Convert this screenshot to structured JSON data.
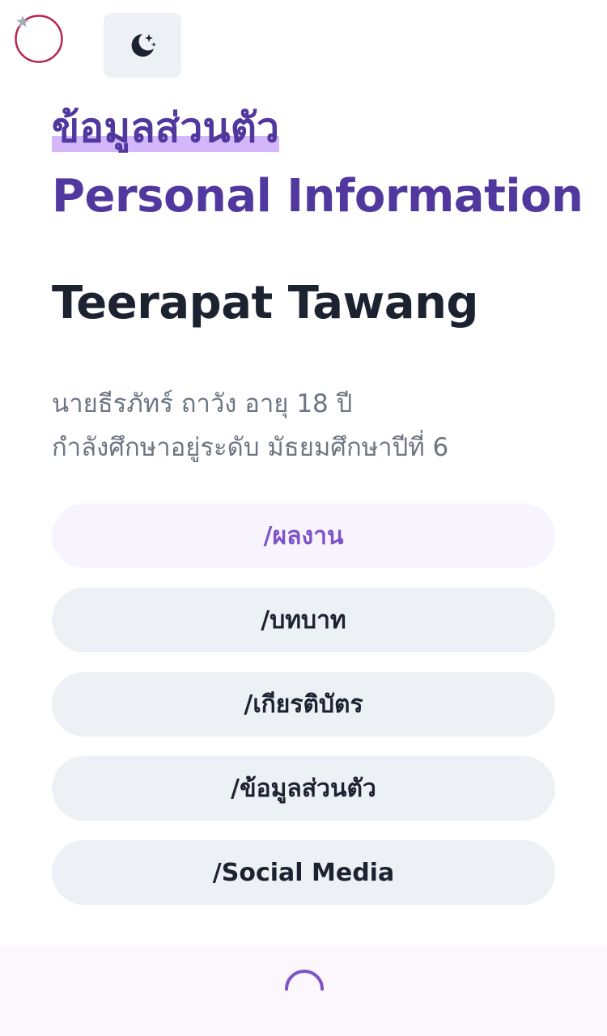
{
  "header": {
    "logo_icon": "circle-logo-icon",
    "theme_toggle_icon": "moon-stars-icon"
  },
  "title": {
    "thai": "ข้อมูลส่วนตัว",
    "english": "Personal Information"
  },
  "profile": {
    "name": "Teerapat Tawang",
    "line1": "นายธีรภัทร์ ถาวัง อายุ 18 ปี",
    "line2": "กำลังศึกษาอยู่ระดับ มัธยมศึกษาปีที่ 6"
  },
  "nav": [
    {
      "label": "/ผลงาน",
      "active": true
    },
    {
      "label": "/บทบาท",
      "active": false
    },
    {
      "label": "/เกียรติบัตร",
      "active": false
    },
    {
      "label": "/ข้อมูลส่วนตัว",
      "active": false
    },
    {
      "label": "/Social Media",
      "active": false
    }
  ],
  "footer": {
    "loading_icon": "loading-spinner-icon"
  },
  "colors": {
    "accent": "#51389e",
    "highlight": "#d4b7fb",
    "text_dark": "#1c2230",
    "text_muted": "#6d7583",
    "button_bg": "#edf1f6",
    "active_bg": "#f8f4fe",
    "active_text": "#7c54c8",
    "logo_ring": "#b5264f"
  }
}
